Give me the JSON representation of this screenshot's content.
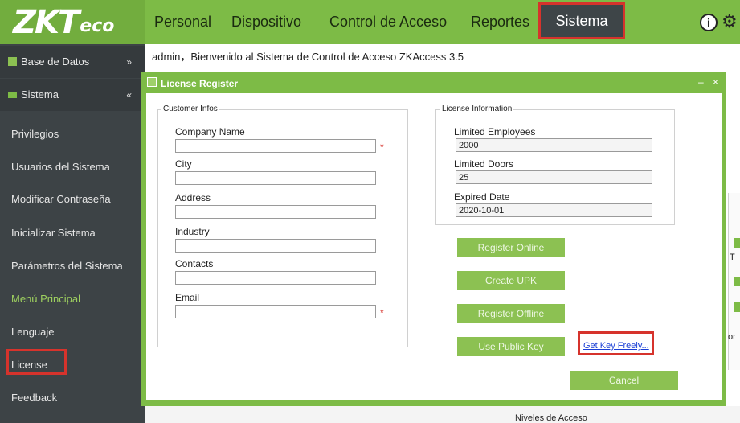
{
  "header": {
    "logo_main": "ZKT",
    "logo_small": "eco",
    "nav": [
      "Personal",
      "Dispositivo",
      "Control de Acceso",
      "Reportes",
      "Sistema"
    ],
    "info_icon_glyph": "i",
    "gear_icon_glyph": "⚙"
  },
  "sidebar": {
    "section_db": "Base de Datos",
    "section_system": "Sistema",
    "items": [
      "Privilegios",
      "Usuarios del Sistema",
      "Modificar Contraseña",
      "Inicializar Sistema",
      "Parámetros del Sistema",
      "Menú Principal",
      "Lenguaje",
      "License",
      "Feedback"
    ],
    "chevron_down": "»",
    "chevron_up": "«"
  },
  "main": {
    "welcome": "admin，Bienvenido al Sistema de Control de Acceso ZKAccess 3.5",
    "bottom_label": "Niveles de Acceso",
    "right_t": "T",
    "right_or": "or"
  },
  "dialog": {
    "title": "License Register",
    "minimize": "–",
    "close": "×",
    "customer": {
      "legend": "Customer Infos",
      "company_label": "Company Name",
      "city_label": "City",
      "address_label": "Address",
      "industry_label": "Industry",
      "contacts_label": "Contacts",
      "email_label": "Email",
      "required_mark": "*"
    },
    "license": {
      "legend": "License Information",
      "employees_label": "Limited Employees",
      "employees_value": "2000",
      "doors_label": "Limited Doors",
      "doors_value": "25",
      "expired_label": "Expired Date",
      "expired_value": "2020-10-01"
    },
    "buttons": {
      "register_online": "Register Online",
      "create_upk": "Create UPK",
      "register_offline": "Register Offline",
      "use_public_key": "Use Public Key",
      "get_key": "Get Key Freely...",
      "cancel": "Cancel"
    }
  },
  "colors": {
    "accent_green": "#7dbb46",
    "sidebar_dark": "#3d4346",
    "highlight_red": "#d6332c"
  }
}
